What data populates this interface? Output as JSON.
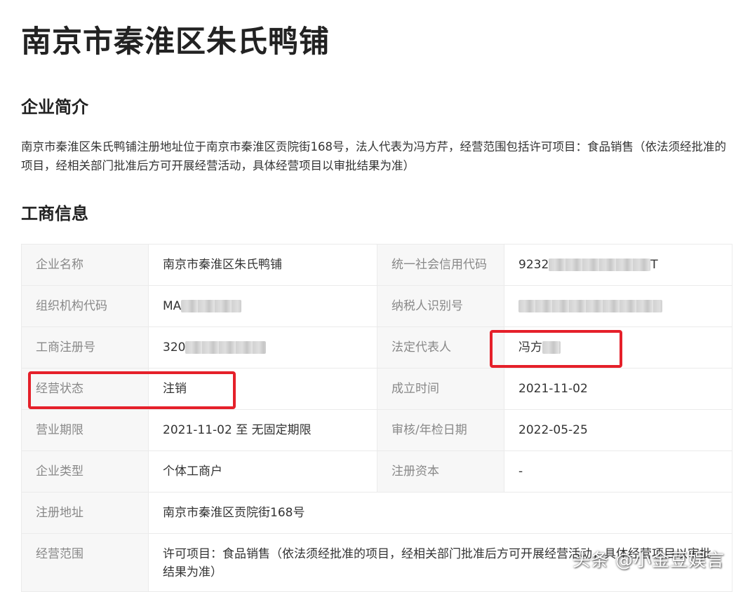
{
  "page": {
    "title": "南京市秦淮区朱氏鸭铺"
  },
  "intro": {
    "heading": "企业简介",
    "text": "南京市秦淮区朱氏鸭铺注册地址位于南京市秦淮区贡院街168号，法人代表为冯方芹，经营范围包括许可项目：食品销售（依法须经批准的项目，经相关部门批准后方可开展经营活动，具体经营项目以审批结果为准）"
  },
  "business": {
    "heading": "工商信息",
    "rows": [
      {
        "k1": "企业名称",
        "v1": "南京市秦淮区朱氏鸭铺",
        "k2": "统一社会信用代码",
        "v2_prefix": "9232",
        "v2_suffix": "T"
      },
      {
        "k1": "组织机构代码",
        "v1_prefix": "MA",
        "k2": "纳税人识别号"
      },
      {
        "k1": "工商注册号",
        "v1_prefix": "320",
        "k2": "法定代表人",
        "v2_prefix": "冯方"
      },
      {
        "k1": "经营状态",
        "v1": "注销",
        "k2": "成立时间",
        "v2": "2021-11-02"
      },
      {
        "k1": "营业期限",
        "v1": "2021-11-02 至 无固定期限",
        "k2": "审核/年检日期",
        "v2": "2022-05-25"
      },
      {
        "k1": "企业类型",
        "v1": "个体工商户",
        "k2": "注册资本",
        "v2": "-"
      },
      {
        "k1": "注册地址",
        "v1": "南京市秦淮区贡院街168号"
      },
      {
        "k1": "经营范围",
        "v1": "许可项目：食品销售（依法须经批准的项目，经相关部门批准后方可开展经营活动，具体经营项目以审批结果为准）"
      }
    ]
  },
  "annotations": {
    "highlight_color": "#e5202a"
  },
  "watermark": {
    "text": "头条 @小金豆娱言"
  }
}
